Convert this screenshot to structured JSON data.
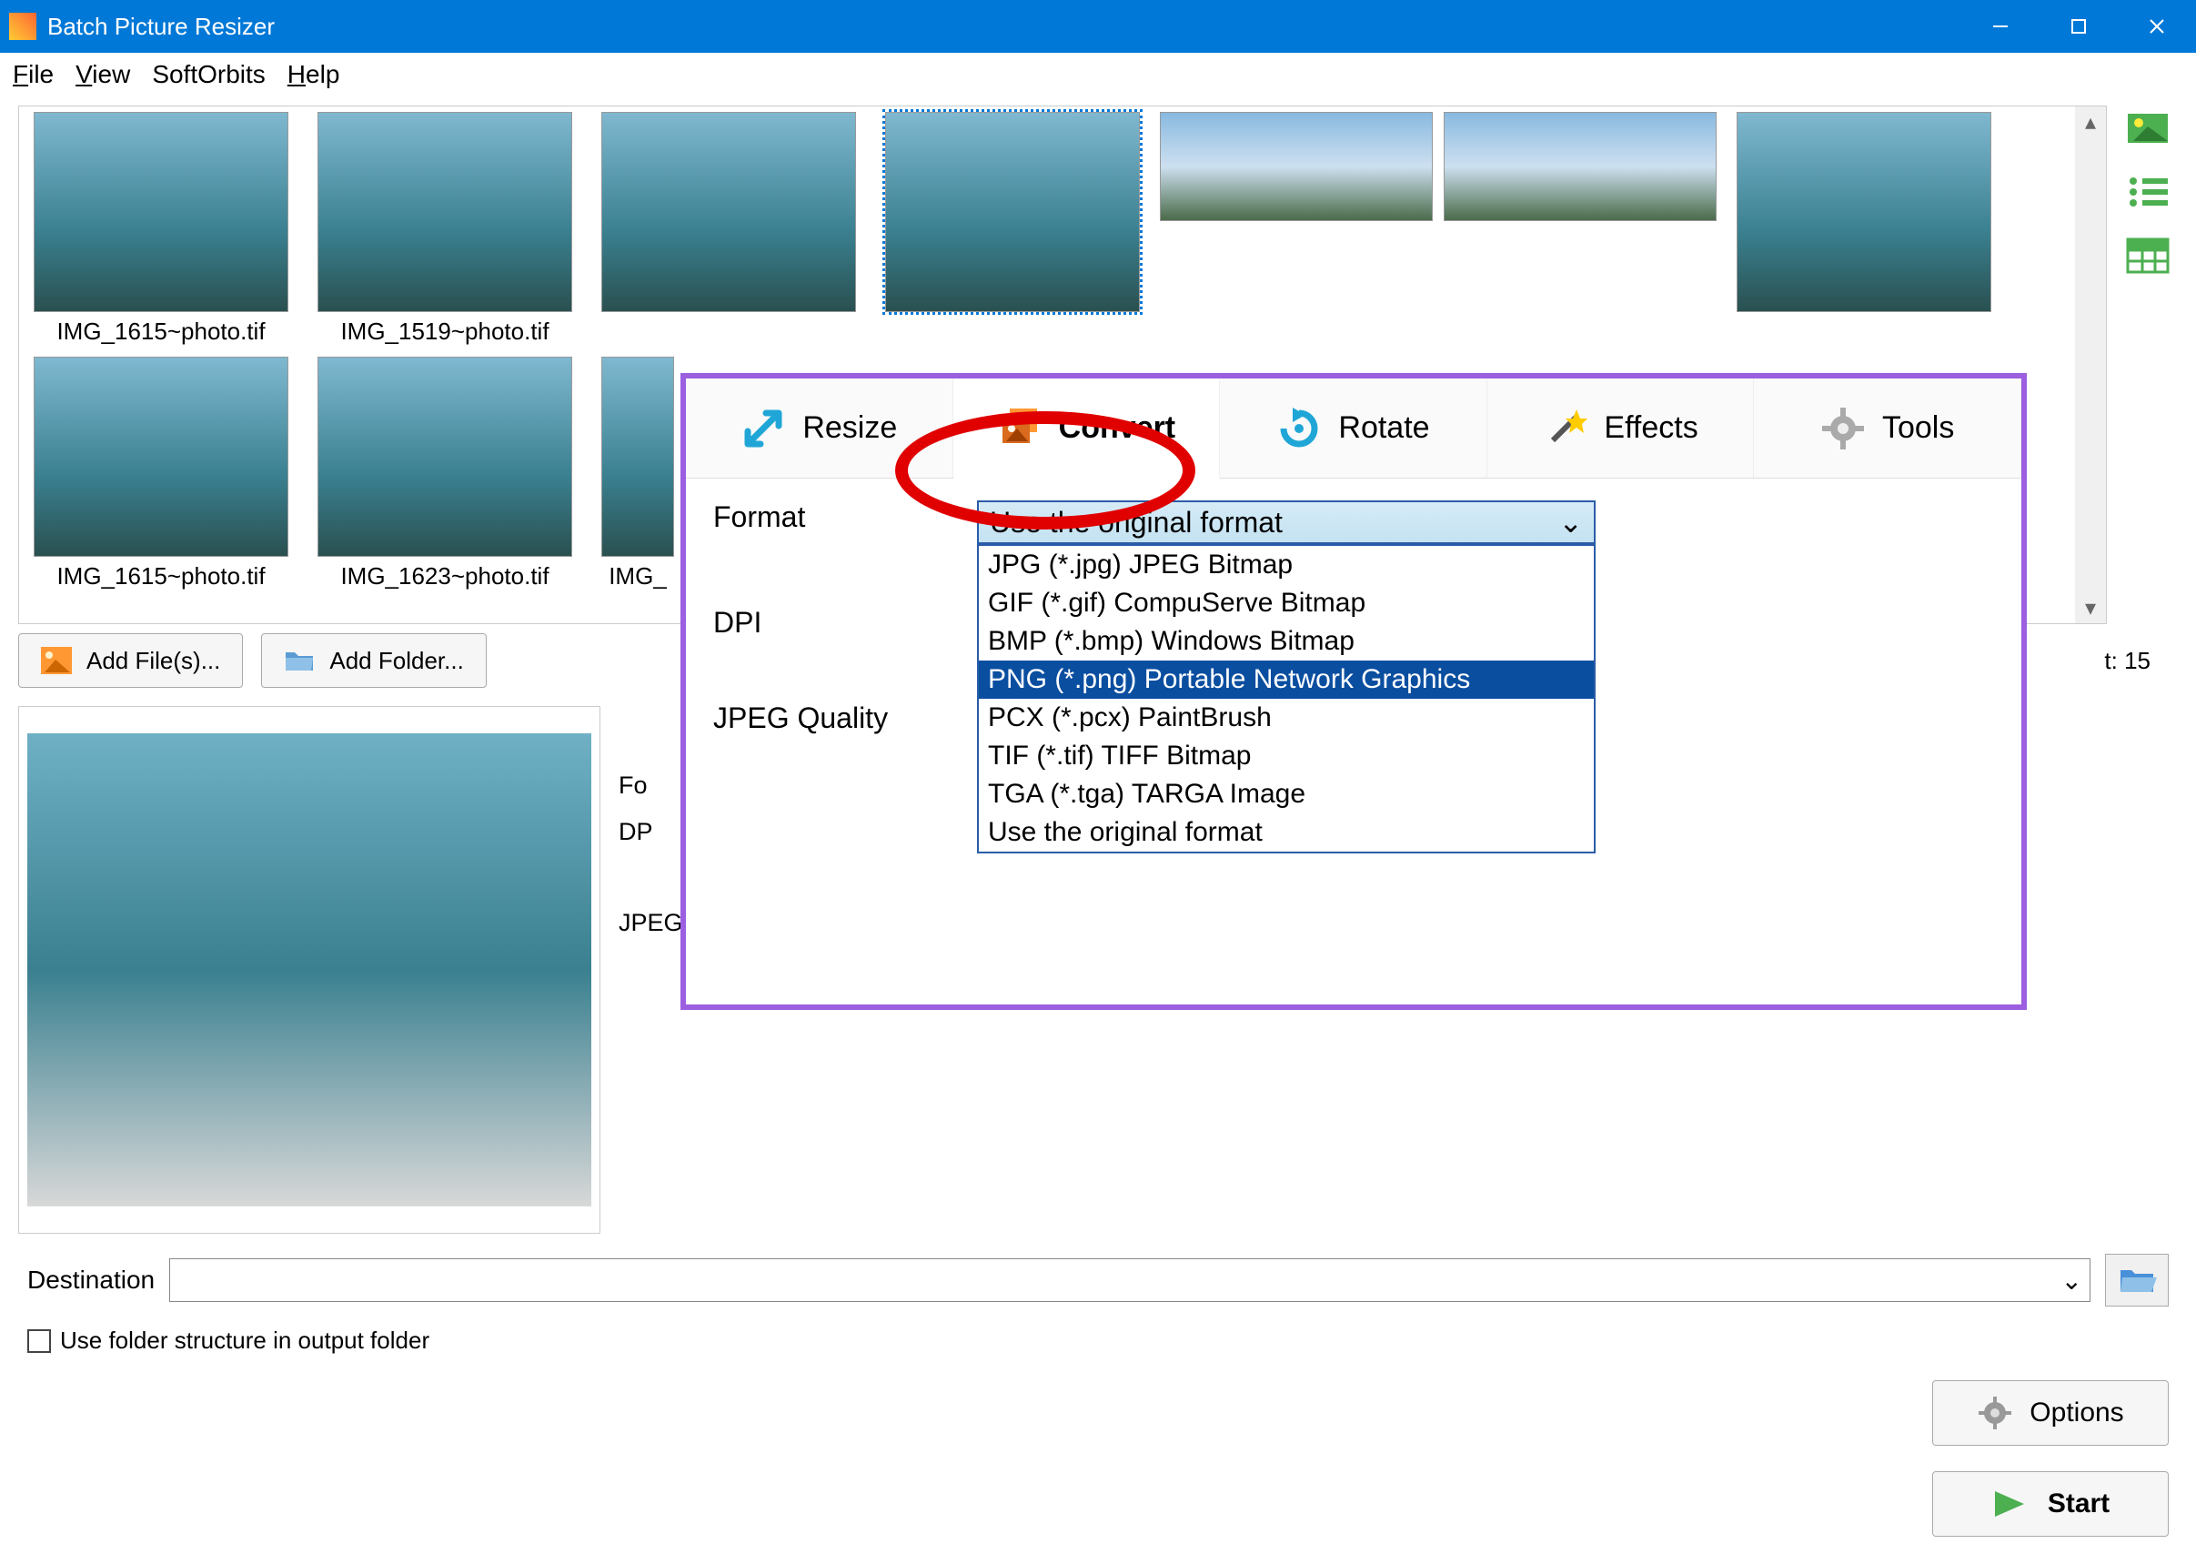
{
  "window": {
    "title": "Batch Picture Resizer"
  },
  "menu": {
    "file": "File",
    "view": "View",
    "softorbits": "SoftOrbits",
    "help": "Help"
  },
  "thumbnails": [
    {
      "label": "IMG_1615~photo.tif"
    },
    {
      "label": "IMG_1519~photo.tif"
    },
    {
      "label": ""
    },
    {
      "label": "",
      "selected": true
    },
    {
      "label": "",
      "wide": true
    },
    {
      "label": "",
      "wide": true
    },
    {
      "label": ""
    },
    {
      "label": "IMG_1615~photo.tif"
    },
    {
      "label": "IMG_1623~photo.tif"
    },
    {
      "label": "IMG_"
    }
  ],
  "buttons": {
    "add_files": "Add File(s)...",
    "add_folder": "Add Folder...",
    "count_label": "t: 15",
    "options": "Options",
    "start": "Start"
  },
  "bg_settings": {
    "format_label": "Fo",
    "dpi_label": "DP",
    "quality_label": "JPEG Quality",
    "format_options": [
      "BMP (*.bmp) Windows Bitmap",
      "PNG (*.png) Portable Network Graphics",
      "PCX (*.pcx) PaintBrush",
      "TIF (*.tif) TIFF Bitmap",
      "TGA (*.tga) TARGA Image",
      "Use the original format"
    ],
    "format_selected_index": 1
  },
  "destination": {
    "label": "Destination",
    "value": "",
    "checkbox_label": "Use folder structure in output folder"
  },
  "overlay": {
    "tabs": {
      "resize": "Resize",
      "convert": "Convert",
      "rotate": "Rotate",
      "effects": "Effects",
      "tools": "Tools"
    },
    "rows": {
      "format": "Format",
      "dpi": "DPI",
      "quality": "JPEG Quality"
    },
    "combo_value": "Use the original format",
    "options": [
      "JPG (*.jpg) JPEG Bitmap",
      "GIF (*.gif) CompuServe Bitmap",
      "BMP (*.bmp) Windows Bitmap",
      "PNG (*.png) Portable Network Graphics",
      "PCX (*.pcx) PaintBrush",
      "TIF (*.tif) TIFF Bitmap",
      "TGA (*.tga) TARGA Image",
      "Use the original format"
    ],
    "hover_index": 3
  }
}
